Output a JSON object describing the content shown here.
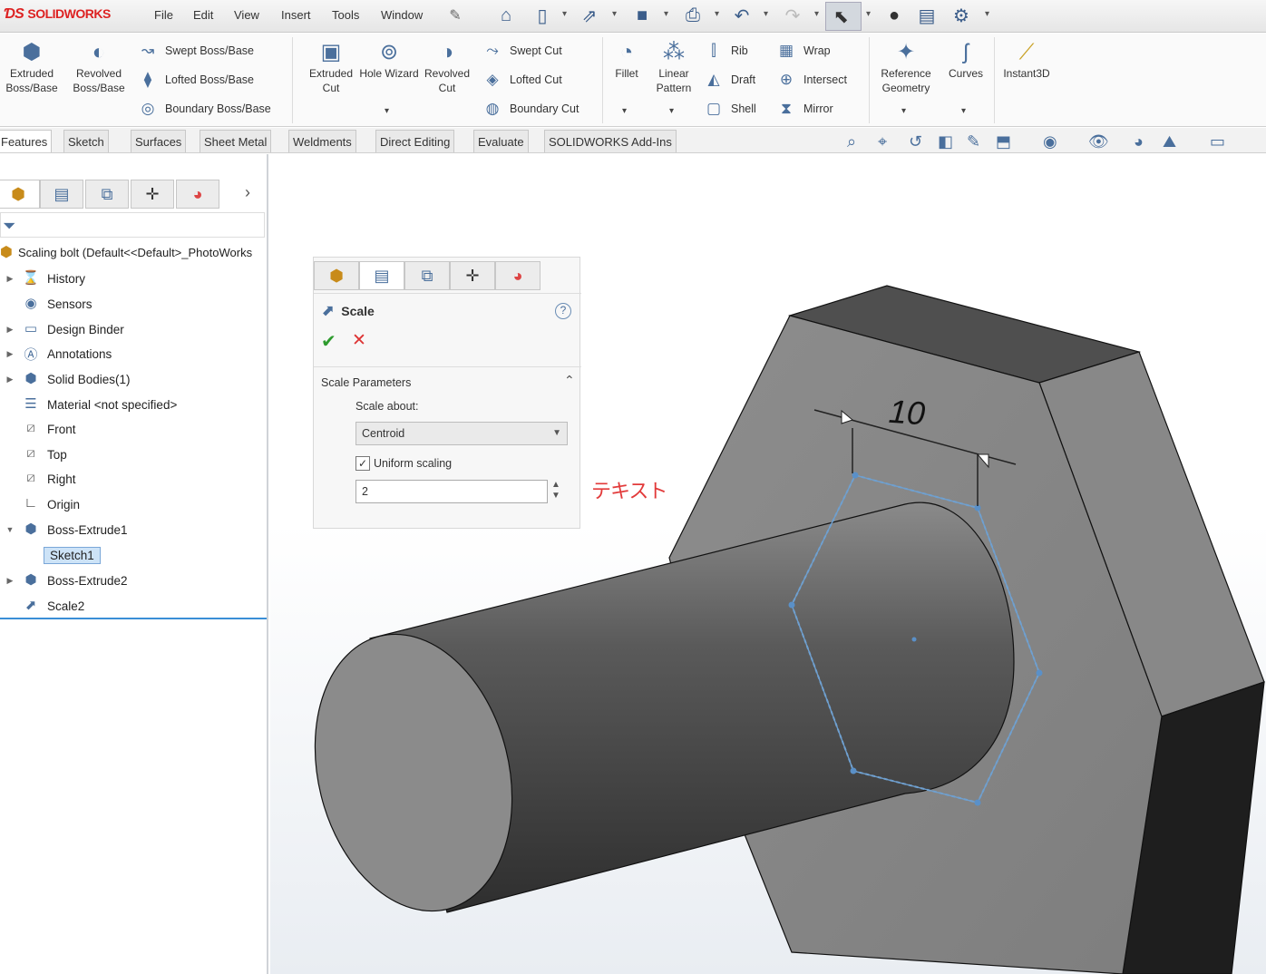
{
  "app": {
    "logo_ds": "ƊS",
    "logo_name": "SOLIDWORKS"
  },
  "menu": [
    "File",
    "Edit",
    "View",
    "Insert",
    "Tools",
    "Window"
  ],
  "ribbon": {
    "extruded_boss": "Extruded Boss/Base",
    "revolved_boss": "Revolved Boss/Base",
    "swept_boss": "Swept Boss/Base",
    "lofted_boss": "Lofted Boss/Base",
    "boundary_boss": "Boundary Boss/Base",
    "extruded_cut": "Extruded Cut",
    "hole_wizard": "Hole Wizard",
    "revolved_cut": "Revolved Cut",
    "swept_cut": "Swept Cut",
    "lofted_cut": "Lofted Cut",
    "boundary_cut": "Boundary Cut",
    "fillet": "Fillet",
    "linear_pattern": "Linear Pattern",
    "rib": "Rib",
    "draft": "Draft",
    "shell": "Shell",
    "wrap": "Wrap",
    "intersect": "Intersect",
    "mirror": "Mirror",
    "reference_geometry": "Reference Geometry",
    "curves": "Curves",
    "instant3d": "Instant3D"
  },
  "tabs": [
    "Features",
    "Sketch",
    "Surfaces",
    "Sheet Metal",
    "Weldments",
    "Direct Editing",
    "Evaluate",
    "SOLIDWORKS Add-Ins"
  ],
  "feature_tree": {
    "root": "Scaling bolt  (Default<<Default>_PhotoWorks",
    "items": [
      {
        "label": "History",
        "icon": "history-icon"
      },
      {
        "label": "Sensors",
        "icon": "sensor-icon"
      },
      {
        "label": "Design Binder",
        "icon": "binder-icon"
      },
      {
        "label": "Annotations",
        "icon": "annotation-icon"
      },
      {
        "label": "Solid Bodies(1)",
        "icon": "solid-bodies-icon"
      },
      {
        "label": "Material <not specified>",
        "icon": "material-icon"
      },
      {
        "label": "Front",
        "icon": "plane-icon"
      },
      {
        "label": "Top",
        "icon": "plane-icon"
      },
      {
        "label": "Right",
        "icon": "plane-icon"
      },
      {
        "label": "Origin",
        "icon": "origin-icon"
      },
      {
        "label": "Boss-Extrude1",
        "icon": "extrude-icon"
      },
      {
        "label": "Sketch1",
        "icon": "sketch-icon"
      },
      {
        "label": "Boss-Extrude2",
        "icon": "extrude-icon"
      },
      {
        "label": "Scale2",
        "icon": "scale-icon"
      }
    ]
  },
  "property_manager": {
    "title": "Scale",
    "help": "?",
    "group_title": "Scale Parameters",
    "scale_about_label": "Scale about:",
    "scale_about_value": "Centroid",
    "uniform_label": "Uniform scaling",
    "uniform_checked": true,
    "scale_value": "2"
  },
  "overlay_text": "テキスト",
  "dimension": "10",
  "colors": {
    "accent": "#3a8ed6",
    "brand_red": "#d22222",
    "ok_green": "#2e9b2e",
    "cancel_red": "#dd3333"
  }
}
